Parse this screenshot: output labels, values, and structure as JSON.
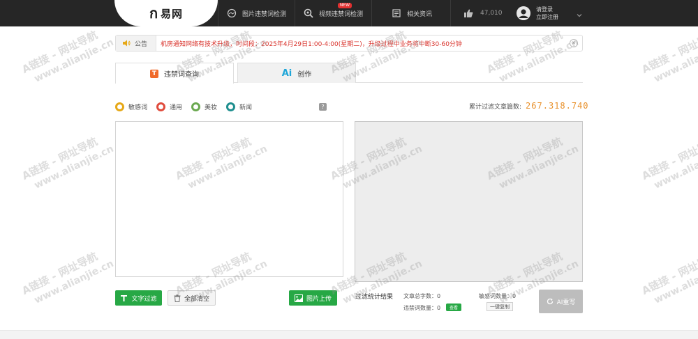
{
  "header": {
    "logo_mark": "ก",
    "logo_text": "易网",
    "nav": [
      {
        "label": "图片违禁词检测"
      },
      {
        "label": "视频违禁词检测",
        "badge": "NEW"
      },
      {
        "label": "相关资讯"
      }
    ],
    "like_count": "47,010",
    "user": {
      "line1": "请登录",
      "line2": "立即注册"
    }
  },
  "notice": {
    "label": "公告",
    "text": "机房通知网络有技术升级，时间段：2025年4月29日1:00-4:00(星期二)，升级过程中业务将中断30-60分钟"
  },
  "tabs": [
    {
      "label": "违禁词查询",
      "icon": "T",
      "active": true
    },
    {
      "label": "创作",
      "icon": "Ai",
      "active": false
    }
  ],
  "radios": [
    {
      "label": "敏感词",
      "color": "#e6a817"
    },
    {
      "label": "通用",
      "color": "#e04b3c"
    },
    {
      "label": "美妆",
      "color": "#6aa84f"
    },
    {
      "label": "新闻",
      "color": "#1f8f8f"
    }
  ],
  "help_label": "?",
  "total": {
    "label": "累计过滤文章篇数:",
    "value": "267.318.740"
  },
  "buttons": {
    "text_filter": "文字过滤",
    "clear_all": "全部清空",
    "image_upload": "图片上传",
    "view": "查看",
    "copy": "一键复制",
    "ai_rewrite": "AI重写"
  },
  "stats": {
    "title": "过滤统计结果",
    "total_chars": "文章总字数：0",
    "banned_count": "违禁词数量：0",
    "sensitive_count": "敏感词数量：0"
  },
  "watermark": {
    "line1": "A链接 - 网址导航",
    "line2": "www.alianjie.cn"
  },
  "colors": {
    "green": "#27a845",
    "header": "#262626",
    "orange": "#e8902a",
    "notice_red": "#d9322b"
  }
}
